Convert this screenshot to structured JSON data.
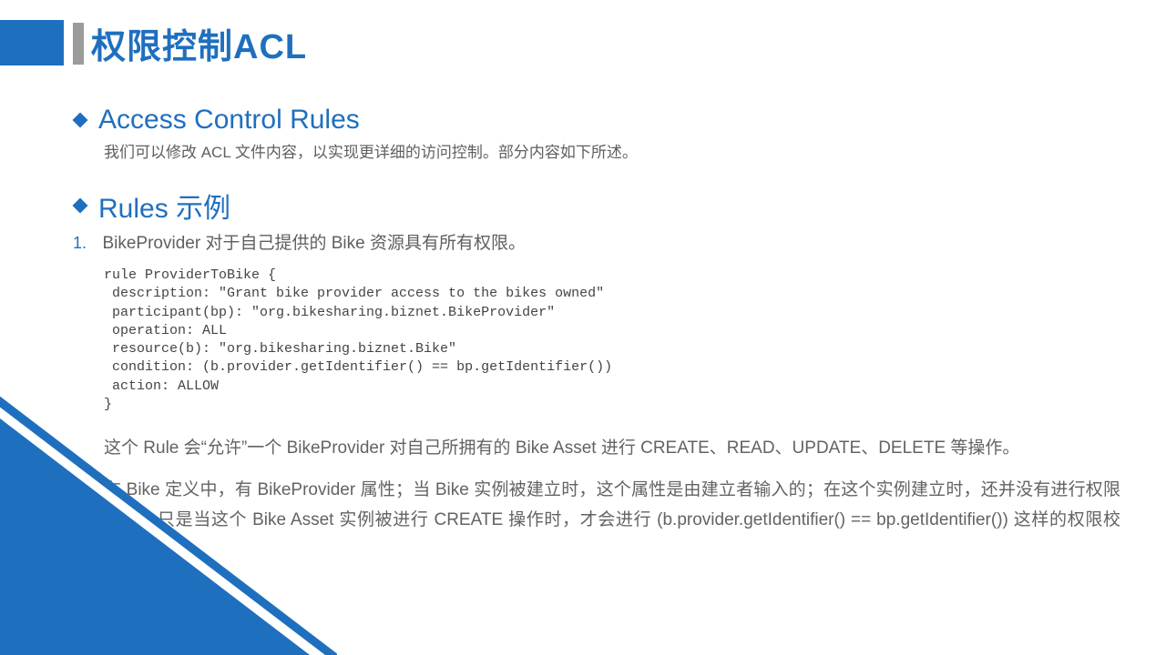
{
  "title": "权限控制ACL",
  "sections": {
    "s1": {
      "heading": "Access Control Rules",
      "desc": "我们可以修改 ACL 文件内容，以实现更详细的访问控制。部分内容如下所述。"
    },
    "s2": {
      "heading": "Rules 示例",
      "item_num": "1.",
      "item_text": "BikeProvider 对于自己提供的 Bike 资源具有所有权限。"
    }
  },
  "code": "rule ProviderToBike {\n description: \"Grant bike provider access to the bikes owned\"\n participant(bp): \"org.bikesharing.biznet.BikeProvider\"\n operation: ALL\n resource(b): \"org.bikesharing.biznet.Bike\"\n condition: (b.provider.getIdentifier() == bp.getIdentifier())\n action: ALLOW\n}",
  "explain": {
    "p1": "这个 Rule 会“允许”一个 BikeProvider 对自己所拥有的 Bike Asset 进行 CREATE、READ、UPDATE、DELETE 等操作。",
    "p2": "在 Bike 定义中，有 BikeProvider 属性；当 Bike 实例被建立时，这个属性是由建立者输入的；在这个实例建立时，还并没有进行权限校验；只是当这个 Bike Asset 实例被进行 CREATE 操作时，才会进行 (b.provider.getIdentifier() == bp.getIdentifier()) 这样的权限校验。"
  }
}
